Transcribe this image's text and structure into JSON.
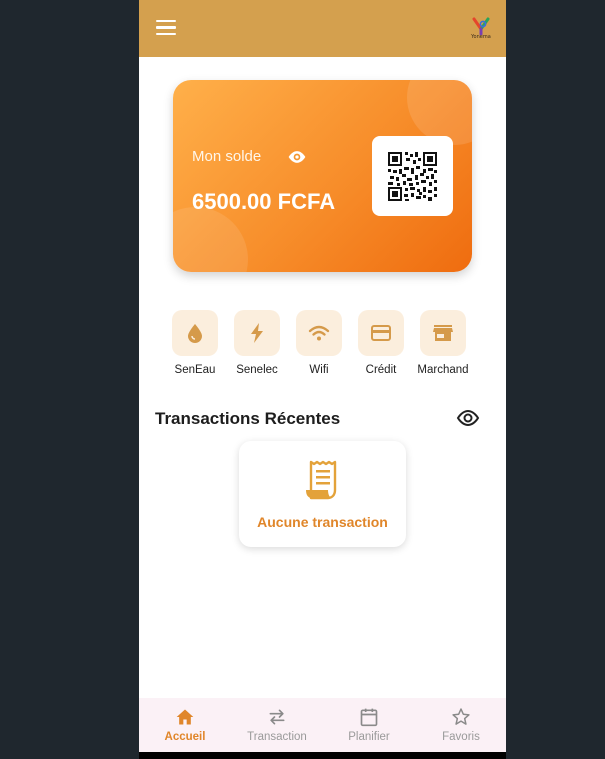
{
  "app": {
    "logo_text": "Yonema",
    "accent_color": "#d4a04e"
  },
  "balance": {
    "label": "Mon solde",
    "amount": "6500.00 FCFA",
    "icon": "eye-icon",
    "qr_icon": "qr-code-icon"
  },
  "services": [
    {
      "label": "SenEau",
      "icon": "water-drop-icon"
    },
    {
      "label": "Senelec",
      "icon": "lightning-bolt-icon"
    },
    {
      "label": "Wifi",
      "icon": "wifi-icon"
    },
    {
      "label": "Crédit",
      "icon": "credit-card-icon"
    },
    {
      "label": "Marchand",
      "icon": "store-icon"
    }
  ],
  "transactions": {
    "title": "Transactions Récentes",
    "empty_text": "Aucune transaction",
    "icon": "receipt-icon"
  },
  "nav": [
    {
      "label": "Accueil",
      "icon": "home-icon",
      "active": true
    },
    {
      "label": "Transaction",
      "icon": "swap-arrows-icon",
      "active": false
    },
    {
      "label": "Planifier",
      "icon": "calendar-icon",
      "active": false
    },
    {
      "label": "Favoris",
      "icon": "star-icon",
      "active": false
    }
  ]
}
